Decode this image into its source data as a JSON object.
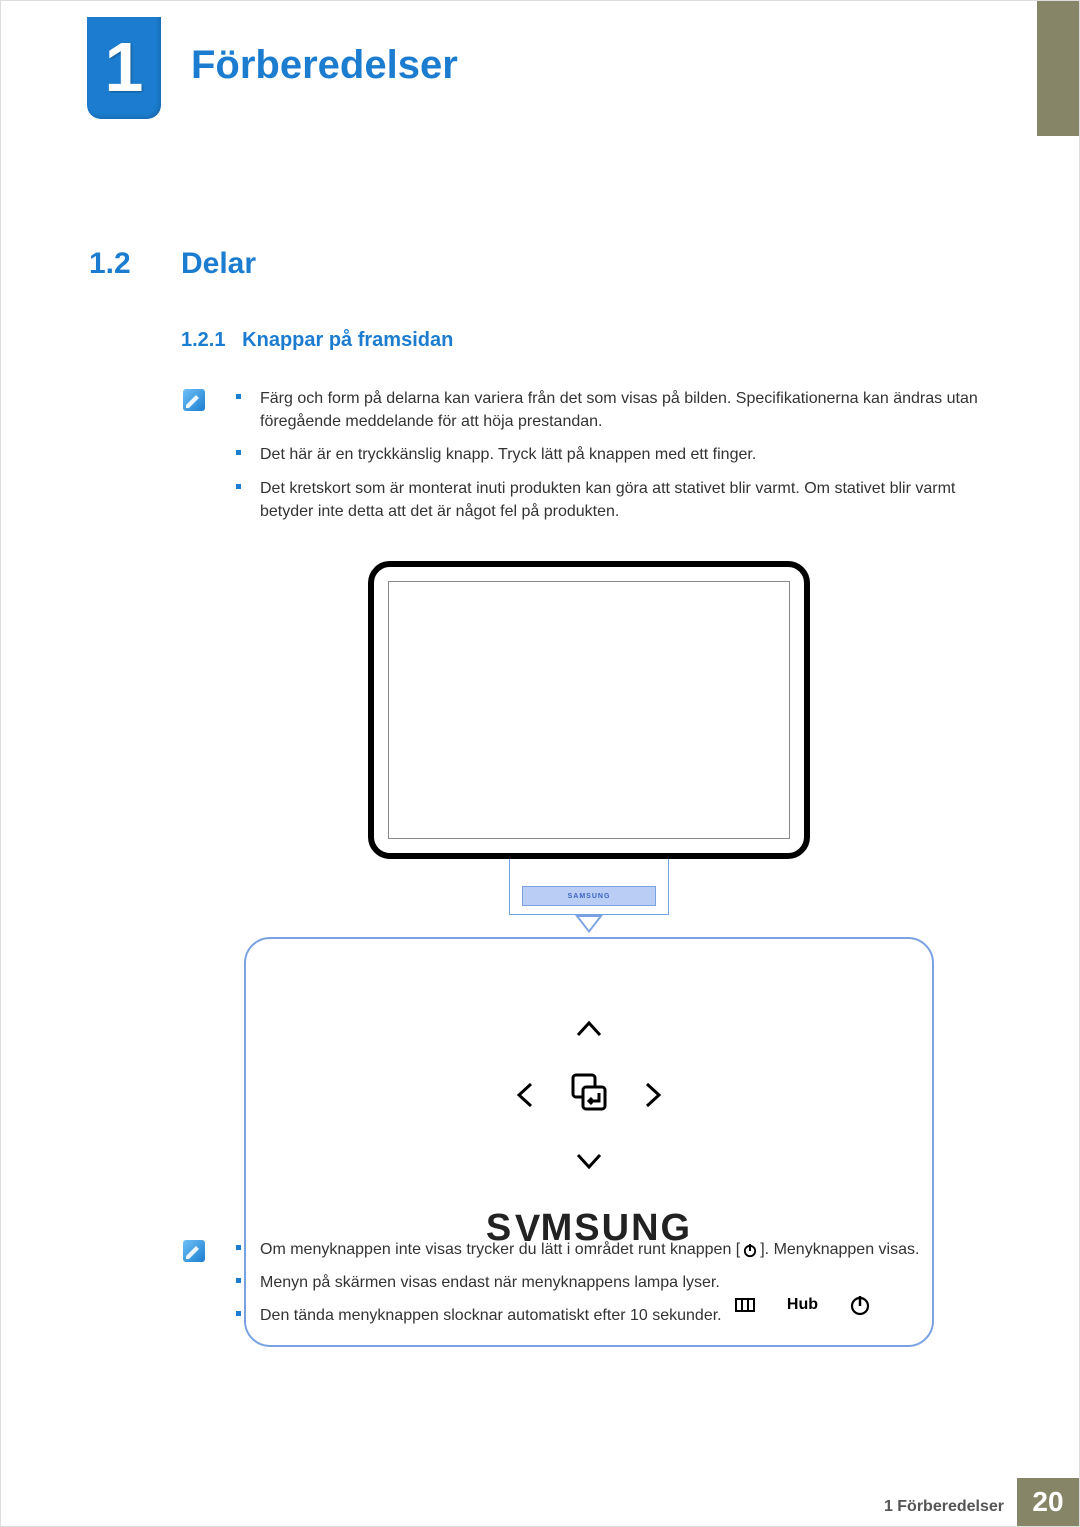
{
  "chapter": {
    "number": "1",
    "title": "Förberedelser"
  },
  "section": {
    "number": "1.2",
    "title": "Delar"
  },
  "subsection": {
    "number": "1.2.1",
    "title": "Knappar på framsidan"
  },
  "notes1": [
    "Färg och form på delarna kan variera från det som visas på bilden. Specifikationerna kan ändras utan föregående meddelande för att höja prestandan.",
    "Det här är en tryckkänslig knapp. Tryck lätt på knappen med ett finger.",
    "Det kretskort som är monterat inuti produkten kan göra att stativet blir varmt. Om stativet blir varmt betyder inte detta att det är något fel på produkten."
  ],
  "notes2": {
    "item1_pre": "Om menyknappen inte visas trycker du lätt i området runt knappen [",
    "item1_post": "]. Menyknappen visas.",
    "item2": "Menyn på skärmen visas endast när menyknappens lampa lyser.",
    "item3": "Den tända menyknappen slocknar automatiskt efter 10 sekunder."
  },
  "figure": {
    "stand_brand": "SAMSUNG",
    "panel_brand": "SΛMSUNG",
    "hub_label": "Hub"
  },
  "footer": {
    "text": "1 Förberedelser",
    "page": "20"
  }
}
